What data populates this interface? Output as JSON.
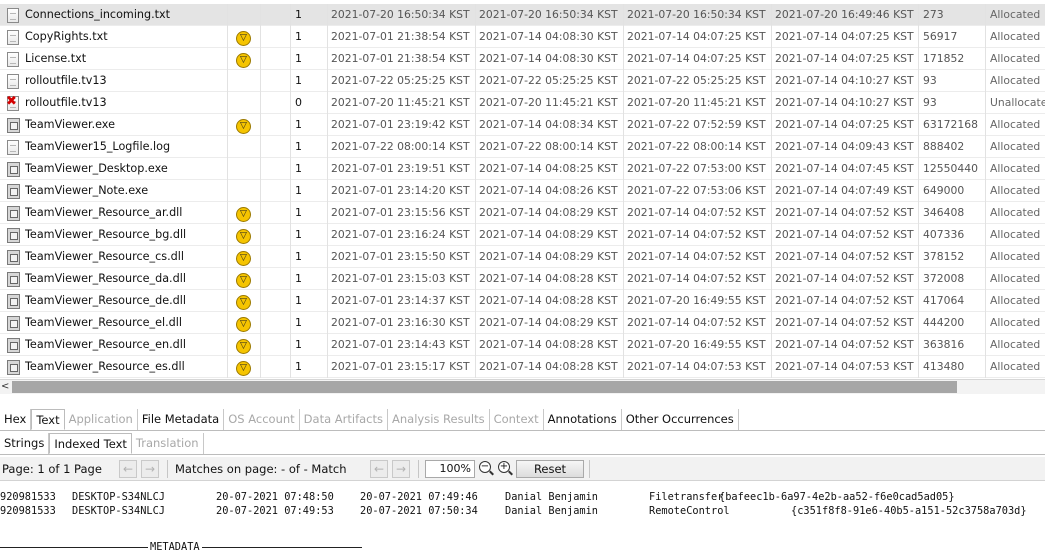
{
  "table": {
    "rows": [
      {
        "icon": "file-icon",
        "name": "Connections_incoming.txt",
        "score": "",
        "count": "1",
        "modified": "2021-07-20 16:50:34 KST",
        "changed": "2021-07-20 16:50:34 KST",
        "accessed": "2021-07-20 16:50:34 KST",
        "created": "2021-07-20 16:49:46 KST",
        "size": "273",
        "flags": "Allocated",
        "selected": true
      },
      {
        "icon": "file-icon",
        "name": "CopyRights.txt",
        "score": "warning",
        "count": "1",
        "modified": "2021-07-01 21:38:54 KST",
        "changed": "2021-07-14 04:08:30 KST",
        "accessed": "2021-07-14 04:07:25 KST",
        "created": "2021-07-14 04:07:25 KST",
        "size": "56917",
        "flags": "Allocated"
      },
      {
        "icon": "file-icon",
        "name": "License.txt",
        "score": "warning",
        "count": "1",
        "modified": "2021-07-01 21:38:54 KST",
        "changed": "2021-07-14 04:08:30 KST",
        "accessed": "2021-07-14 04:07:25 KST",
        "created": "2021-07-14 04:07:25 KST",
        "size": "171852",
        "flags": "Allocated"
      },
      {
        "icon": "file-icon",
        "name": "rolloutfile.tv13",
        "score": "",
        "count": "1",
        "modified": "2021-07-22 05:25:25 KST",
        "changed": "2021-07-22 05:25:25 KST",
        "accessed": "2021-07-22 05:25:25 KST",
        "created": "2021-07-14 04:10:27 KST",
        "size": "93",
        "flags": "Allocated"
      },
      {
        "icon": "deleted-file-icon",
        "name": "rolloutfile.tv13",
        "score": "",
        "count": "0",
        "modified": "2021-07-20 11:45:21 KST",
        "changed": "2021-07-20 11:45:21 KST",
        "accessed": "2021-07-20 11:45:21 KST",
        "created": "2021-07-14 04:10:27 KST",
        "size": "93",
        "flags": "Unallocated"
      },
      {
        "icon": "executable-icon",
        "name": "TeamViewer.exe",
        "score": "warning",
        "count": "1",
        "modified": "2021-07-01 23:19:42 KST",
        "changed": "2021-07-14 04:08:34 KST",
        "accessed": "2021-07-22 07:52:59 KST",
        "created": "2021-07-14 04:07:25 KST",
        "size": "63172168",
        "flags": "Allocated"
      },
      {
        "icon": "file-icon",
        "name": "TeamViewer15_Logfile.log",
        "score": "",
        "count": "1",
        "modified": "2021-07-22 08:00:14 KST",
        "changed": "2021-07-22 08:00:14 KST",
        "accessed": "2021-07-22 08:00:14 KST",
        "created": "2021-07-14 04:09:43 KST",
        "size": "888402",
        "flags": "Allocated"
      },
      {
        "icon": "executable-icon",
        "name": "TeamViewer_Desktop.exe",
        "score": "",
        "count": "1",
        "modified": "2021-07-01 23:19:51 KST",
        "changed": "2021-07-14 04:08:25 KST",
        "accessed": "2021-07-22 07:53:00 KST",
        "created": "2021-07-14 04:07:45 KST",
        "size": "12550440",
        "flags": "Allocated"
      },
      {
        "icon": "executable-icon",
        "name": "TeamViewer_Note.exe",
        "score": "",
        "count": "1",
        "modified": "2021-07-01 23:14:20 KST",
        "changed": "2021-07-14 04:08:26 KST",
        "accessed": "2021-07-22 07:53:06 KST",
        "created": "2021-07-14 04:07:49 KST",
        "size": "649000",
        "flags": "Allocated"
      },
      {
        "icon": "executable-icon",
        "name": "TeamViewer_Resource_ar.dll",
        "score": "warning",
        "count": "1",
        "modified": "2021-07-01 23:15:56 KST",
        "changed": "2021-07-14 04:08:29 KST",
        "accessed": "2021-07-14 04:07:52 KST",
        "created": "2021-07-14 04:07:52 KST",
        "size": "346408",
        "flags": "Allocated"
      },
      {
        "icon": "executable-icon",
        "name": "TeamViewer_Resource_bg.dll",
        "score": "warning",
        "count": "1",
        "modified": "2021-07-01 23:16:24 KST",
        "changed": "2021-07-14 04:08:29 KST",
        "accessed": "2021-07-14 04:07:52 KST",
        "created": "2021-07-14 04:07:52 KST",
        "size": "407336",
        "flags": "Allocated"
      },
      {
        "icon": "executable-icon",
        "name": "TeamViewer_Resource_cs.dll",
        "score": "warning",
        "count": "1",
        "modified": "2021-07-01 23:15:50 KST",
        "changed": "2021-07-14 04:08:29 KST",
        "accessed": "2021-07-14 04:07:52 KST",
        "created": "2021-07-14 04:07:52 KST",
        "size": "378152",
        "flags": "Allocated"
      },
      {
        "icon": "executable-icon",
        "name": "TeamViewer_Resource_da.dll",
        "score": "warning",
        "count": "1",
        "modified": "2021-07-01 23:15:03 KST",
        "changed": "2021-07-14 04:08:28 KST",
        "accessed": "2021-07-14 04:07:52 KST",
        "created": "2021-07-14 04:07:52 KST",
        "size": "372008",
        "flags": "Allocated"
      },
      {
        "icon": "executable-icon",
        "name": "TeamViewer_Resource_de.dll",
        "score": "warning",
        "count": "1",
        "modified": "2021-07-01 23:14:37 KST",
        "changed": "2021-07-14 04:08:28 KST",
        "accessed": "2021-07-20 16:49:55 KST",
        "created": "2021-07-14 04:07:52 KST",
        "size": "417064",
        "flags": "Allocated"
      },
      {
        "icon": "executable-icon",
        "name": "TeamViewer_Resource_el.dll",
        "score": "warning",
        "count": "1",
        "modified": "2021-07-01 23:16:30 KST",
        "changed": "2021-07-14 04:08:29 KST",
        "accessed": "2021-07-14 04:07:52 KST",
        "created": "2021-07-14 04:07:52 KST",
        "size": "444200",
        "flags": "Allocated"
      },
      {
        "icon": "executable-icon",
        "name": "TeamViewer_Resource_en.dll",
        "score": "warning",
        "count": "1",
        "modified": "2021-07-01 23:14:43 KST",
        "changed": "2021-07-14 04:08:28 KST",
        "accessed": "2021-07-20 16:49:55 KST",
        "created": "2021-07-14 04:07:52 KST",
        "size": "363816",
        "flags": "Allocated"
      },
      {
        "icon": "executable-icon",
        "name": "TeamViewer_Resource_es.dll",
        "score": "warning",
        "count": "1",
        "modified": "2021-07-01 23:15:17 KST",
        "changed": "2021-07-14 04:08:28 KST",
        "accessed": "2021-07-14 04:07:53 KST",
        "created": "2021-07-14 04:07:53 KST",
        "size": "413480",
        "flags": "Allocated"
      }
    ]
  },
  "scrollbar": {
    "left_arrow": "<"
  },
  "tabs_main": [
    {
      "label": "Hex",
      "disabled": false
    },
    {
      "label": "Text",
      "disabled": false,
      "active": true
    },
    {
      "label": "Application",
      "disabled": true
    },
    {
      "label": "File Metadata",
      "disabled": false
    },
    {
      "label": "OS Account",
      "disabled": true
    },
    {
      "label": "Data Artifacts",
      "disabled": true
    },
    {
      "label": "Analysis Results",
      "disabled": true
    },
    {
      "label": "Context",
      "disabled": true
    },
    {
      "label": "Annotations",
      "disabled": false
    },
    {
      "label": "Other Occurrences",
      "disabled": false
    }
  ],
  "tabs_sub": [
    {
      "label": "Strings",
      "disabled": false
    },
    {
      "label": "Indexed Text",
      "disabled": false,
      "active": true
    },
    {
      "label": "Translation",
      "disabled": true
    }
  ],
  "toolbar": {
    "page_label": "Page: 1 of 1 Page",
    "prev_page": "←",
    "next_page": "→",
    "matches_label": "Matches on page:  -  of  -  Match",
    "prev_match": "←",
    "next_match": "→",
    "zoom_value": "100%",
    "zoom_out": "−",
    "zoom_in": "+",
    "reset_label": "Reset"
  },
  "content": {
    "lines": [
      {
        "id": "920981533",
        "host": "DESKTOP-S34NLCJ",
        "start": "20-07-2021 07:48:50",
        "end": "20-07-2021 07:49:46",
        "user": "Danial Benjamin",
        "type": "Filetransfer",
        "guid": "{bafeec1b-6a97-4e2b-aa52-f6e0cad5ad05}"
      },
      {
        "id": "920981533",
        "host": "DESKTOP-S34NLCJ",
        "start": "20-07-2021 07:49:53",
        "end": "20-07-2021 07:50:34",
        "user": "Danial Benjamin",
        "type": "RemoteControl",
        "guid": "{c351f8f8-91e6-40b5-a151-52c3758a703d}"
      }
    ],
    "metadata_label": "METADATA"
  },
  "colors": {
    "warning": "#f5c400",
    "deleted": "#d40000",
    "selected_row": "#e4e4e4",
    "scroll_thumb": "#a6a6a6"
  }
}
